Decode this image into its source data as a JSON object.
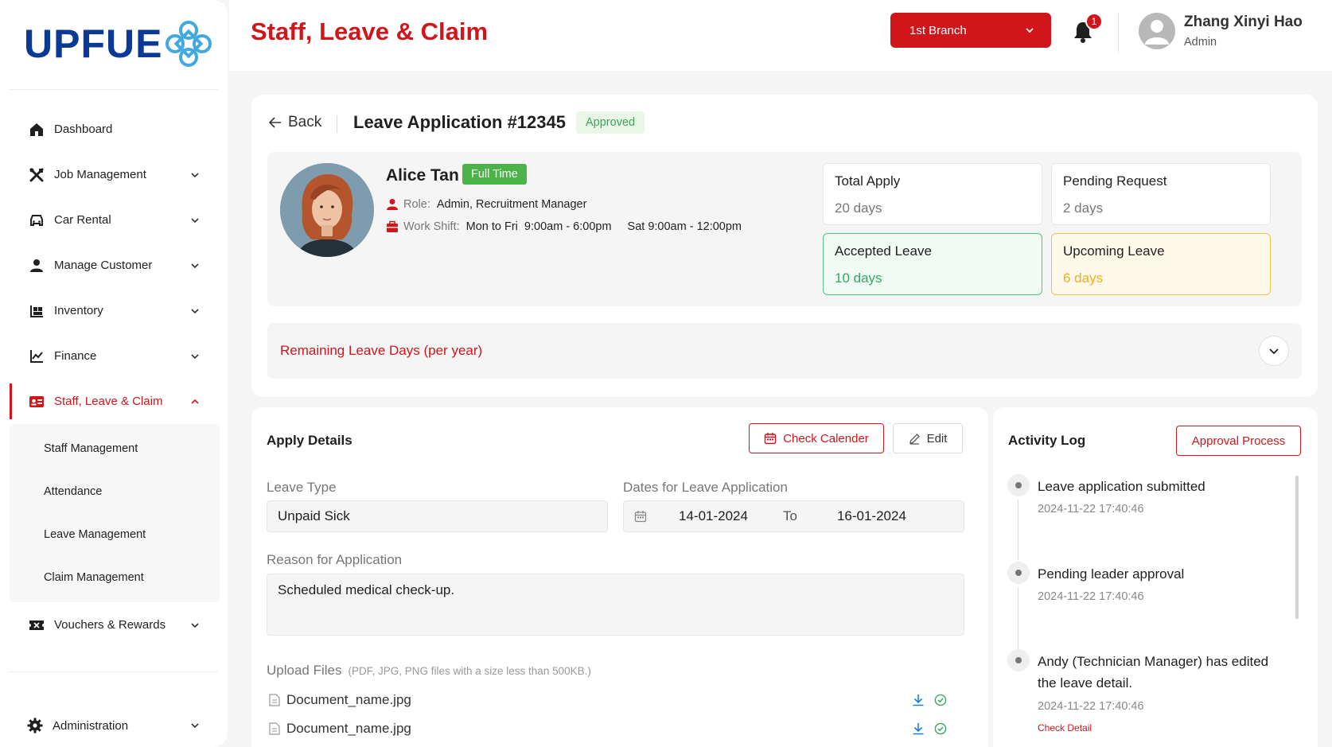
{
  "brand": {
    "logo_text": "UPFUE",
    "accent": "#d0161b",
    "brand_blue": "#0a3a96"
  },
  "sidebar": {
    "items": [
      {
        "label": "Dashboard",
        "icon": "home-icon"
      },
      {
        "label": "Job Management",
        "icon": "tools-icon"
      },
      {
        "label": "Car Rental",
        "icon": "car-icon"
      },
      {
        "label": "Manage Customer",
        "icon": "user-icon"
      },
      {
        "label": "Inventory",
        "icon": "inventory-icon"
      },
      {
        "label": "Finance",
        "icon": "chart-line-icon"
      },
      {
        "label": "Staff, Leave & Claim",
        "icon": "id-card-icon"
      }
    ],
    "sub_items": [
      {
        "label": "Staff Management"
      },
      {
        "label": "Attendance"
      },
      {
        "label": "Leave Management"
      },
      {
        "label": "Claim Management"
      }
    ],
    "vouchers": {
      "label": "Vouchers & Rewards",
      "icon": "ticket-icon"
    },
    "administration": {
      "label": "Administration",
      "icon": "gear-icon"
    }
  },
  "header": {
    "title": "Staff, Leave & Claim",
    "branch": "1st Branch",
    "notification_count": "1",
    "user_name": "Zhang Xinyi Hao",
    "user_role": "Admin"
  },
  "application": {
    "back_label": "Back",
    "title": "Leave Application #12345",
    "status": "Approved",
    "employee": {
      "name": "Alice Tan",
      "type": "Full Time",
      "role_label": "Role:",
      "role": "Admin, Recruitment Manager",
      "shift_label": "Work Shift:",
      "shift_weekdays": "Mon to Fri",
      "shift_weekday_hours": "9:00am - 6:00pm",
      "shift_saturday": "Sat 9:00am - 12:00pm"
    },
    "stats": {
      "total_apply": {
        "label": "Total Apply",
        "value": "20 days"
      },
      "pending_request": {
        "label": "Pending Request",
        "value": "2 days"
      },
      "accepted_leave": {
        "label": "Accepted Leave",
        "value": "10 days"
      },
      "upcoming_leave": {
        "label": "Upcoming Leave",
        "value": "6 days"
      }
    },
    "remaining_label": "Remaining Leave Days (per year)"
  },
  "apply_details": {
    "title": "Apply Details",
    "check_calendar": "Check Calender",
    "edit": "Edit",
    "leave_type_label": "Leave Type",
    "leave_type": "Unpaid Sick",
    "dates_label": "Dates for Leave Application",
    "date_from": "14-01-2024",
    "date_to_label": "To",
    "date_to": "16-01-2024",
    "reason_label": "Reason for Application",
    "reason": "Scheduled medical check-up.",
    "upload_label": "Upload Files",
    "upload_hint": "(PDF, JPG, PNG files with a size less than 500KB.)",
    "files": [
      {
        "name": "Document_name.jpg"
      },
      {
        "name": "Document_name.jpg"
      }
    ]
  },
  "activity_log": {
    "title": "Activity Log",
    "approval_process": "Approval Process",
    "entries": [
      {
        "text": "Leave application submitted",
        "time": "2024-11-22 17:40:46"
      },
      {
        "text": "Pending leader approval",
        "time": "2024-11-22 17:40:46"
      },
      {
        "text": "Andy (Technician Manager) has edited the leave detail.",
        "time": "2024-11-22 17:40:46",
        "link": "Check Detail"
      }
    ]
  }
}
